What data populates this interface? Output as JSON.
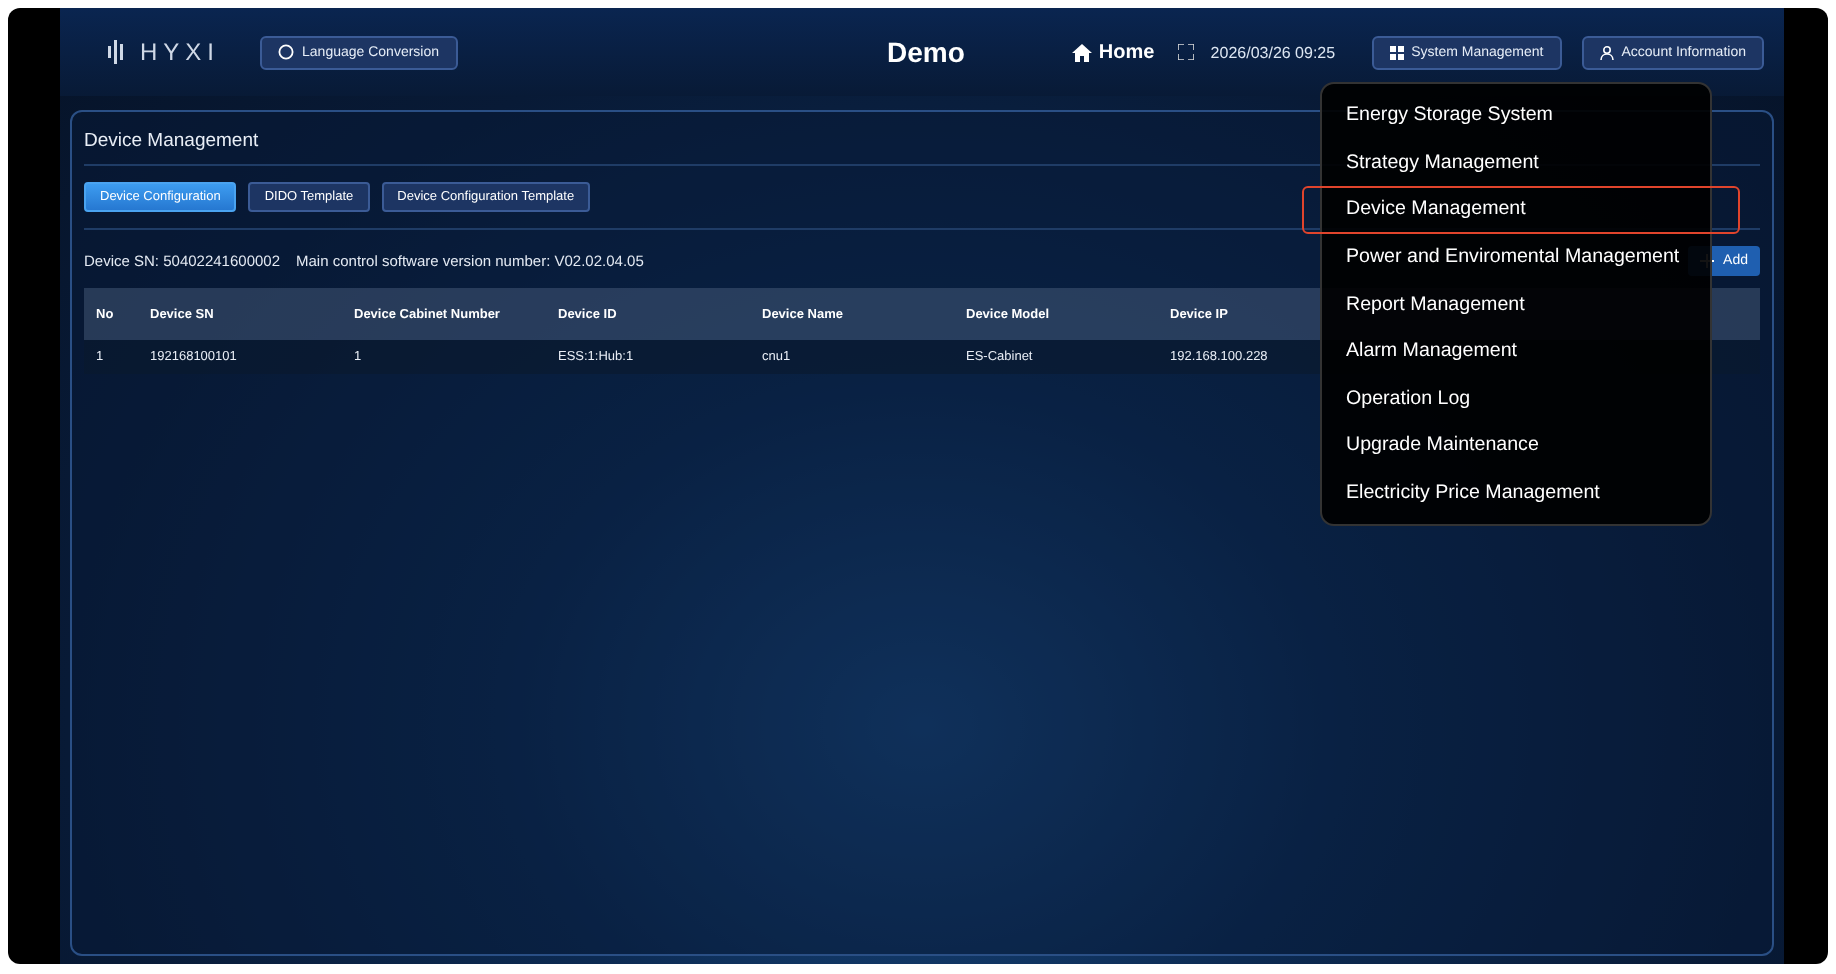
{
  "header": {
    "logo": "HYXI",
    "language_button": "Language Conversion",
    "title": "Demo",
    "home_link": "Home",
    "datetime": "2026/03/26 09:25",
    "system_button": "System Management",
    "account_button": "Account Information"
  },
  "panel": {
    "title": "Device Management",
    "tabs": [
      {
        "label": "Device Configuration",
        "selected": true
      },
      {
        "label": "DIDO Template",
        "selected": false
      },
      {
        "label": "Device Configuration Template",
        "selected": false
      }
    ],
    "info": [
      {
        "label": "Device SN:",
        "value": "50402241600002"
      },
      {
        "label": "Main control software version number:",
        "value": "V02.02.04.05"
      }
    ],
    "add_button": "Add",
    "table": {
      "columns": [
        "No",
        "Device SN",
        "Device Cabinet Number",
        "Device ID",
        "Device Name",
        "Device Model",
        "Device IP"
      ],
      "rows": [
        [
          "1",
          "192168100101",
          "1",
          "ESS:1:Hub:1",
          "cnu1",
          "ES-Cabinet",
          "192.168.100.228"
        ]
      ]
    }
  },
  "menu": {
    "items": [
      {
        "label": "Energy Storage System",
        "selected": false
      },
      {
        "label": "Strategy Management",
        "selected": false
      },
      {
        "label": "Device Management",
        "selected": true
      },
      {
        "label": "Power and Enviromental Management",
        "selected": false
      },
      {
        "label": "Report Management",
        "selected": false
      },
      {
        "label": "Alarm Management",
        "selected": false
      },
      {
        "label": "Operation Log",
        "selected": false
      },
      {
        "label": "Upgrade Maintenance",
        "selected": false
      },
      {
        "label": "Electricity Price Management",
        "selected": false
      }
    ]
  }
}
